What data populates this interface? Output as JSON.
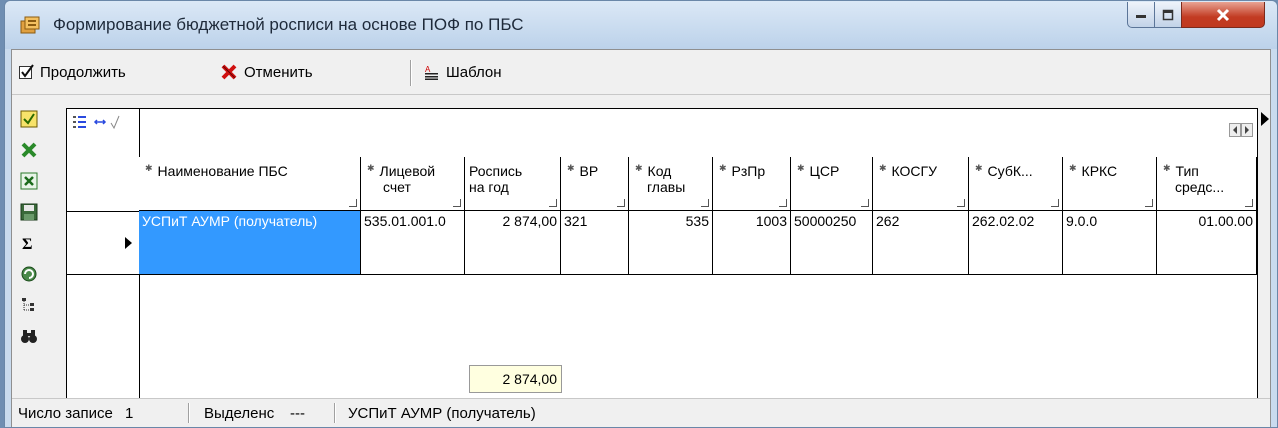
{
  "window": {
    "title": "Формирование бюджетной росписи на основе ПОФ по ПБС"
  },
  "toolbar": {
    "continue_label": "Продолжить",
    "cancel_label": "Отменить",
    "template_label": "Шаблон"
  },
  "grid": {
    "columns": [
      {
        "line1": "Наименование ПБС",
        "line2": ""
      },
      {
        "line1": "Лицевой",
        "line2": "счет"
      },
      {
        "line1": "Роспись",
        "line2": "на год"
      },
      {
        "line1": "ВР",
        "line2": ""
      },
      {
        "line1": "Код",
        "line2": "главы"
      },
      {
        "line1": "РзПр",
        "line2": ""
      },
      {
        "line1": "ЦСР",
        "line2": ""
      },
      {
        "line1": "КОСГУ",
        "line2": ""
      },
      {
        "line1": "СубК...",
        "line2": ""
      },
      {
        "line1": "КРКС",
        "line2": ""
      },
      {
        "line1": "Тип",
        "line2": "средс..."
      }
    ],
    "row": [
      "УСПиТ АУМР (получатель)",
      "535.01.001.0",
      "2 874,00",
      "321",
      "535",
      "1003",
      "50000250",
      "262",
      "262.02.02",
      "9.0.0",
      "01.00.00"
    ],
    "total": "2 874,00"
  },
  "statusbar": {
    "records_label": "Число записе",
    "records_value": "1",
    "selected_label": "Выделенс",
    "selected_value": "---",
    "current_name": "УСПиТ АУМР (получатель)"
  },
  "colors": {
    "selection": "#3399ff",
    "total_bg": "#ffffe0",
    "close_button": "#c23b22"
  }
}
